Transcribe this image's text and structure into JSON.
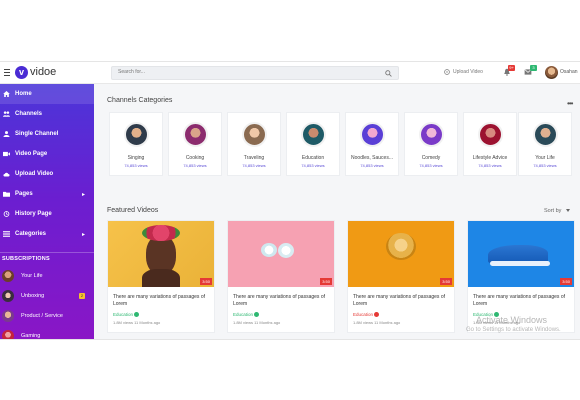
{
  "app": {
    "logo_letter": "v",
    "logo_text": "vidoe"
  },
  "header": {
    "search_placeholder": "Search for...",
    "upload_label": "Upload Video",
    "notifications_count": "9+",
    "messages_count": "3",
    "user_name": "Osahan"
  },
  "sidebar": {
    "items": [
      {
        "label": "Home",
        "icon": "home-icon",
        "has_chevron": false
      },
      {
        "label": "Channels",
        "icon": "users-icon",
        "has_chevron": false
      },
      {
        "label": "Single Channel",
        "icon": "user-icon",
        "has_chevron": false
      },
      {
        "label": "Video Page",
        "icon": "video-icon",
        "has_chevron": false
      },
      {
        "label": "Upload Video",
        "icon": "cloud-upload-icon",
        "has_chevron": false
      },
      {
        "label": "Pages",
        "icon": "folder-icon",
        "has_chevron": true
      },
      {
        "label": "History Page",
        "icon": "history-icon",
        "has_chevron": false
      },
      {
        "label": "Categories",
        "icon": "list-icon",
        "has_chevron": true
      }
    ],
    "subscriptions_title": "SUBSCRIPTIONS",
    "subscriptions": [
      {
        "label": "Your Life",
        "count": ""
      },
      {
        "label": "Unboxing",
        "count": "2"
      },
      {
        "label": "Product / Service",
        "count": ""
      },
      {
        "label": "Gaming",
        "count": ""
      }
    ]
  },
  "categories": {
    "title": "Channels Categories",
    "items": [
      {
        "name": "Singing",
        "views": "74,853 views"
      },
      {
        "name": "Cooking",
        "views": "74,853 views"
      },
      {
        "name": "Traveling",
        "views": "74,853 views"
      },
      {
        "name": "Education",
        "views": "74,853 views"
      },
      {
        "name": "Noodles, Sauces...",
        "views": "74,853 views"
      },
      {
        "name": "Comedy",
        "views": "74,853 views"
      },
      {
        "name": "Lifestyle Advice",
        "views": "74,853 views"
      },
      {
        "name": "Your Life",
        "views": "74,853 views"
      }
    ]
  },
  "featured": {
    "title": "Featured Videos",
    "sort_label": "Sort by",
    "videos": [
      {
        "title": "There are many variations of passages of Lorem",
        "channel": "Education",
        "meta": "1.8M views  11 Months ago",
        "duration": "3:50"
      },
      {
        "title": "There are many variations of passages of Lorem",
        "channel": "Education",
        "meta": "1.8M views  11 Months ago",
        "duration": "3:50"
      },
      {
        "title": "There are many variations of passages of Lorem",
        "channel": "Education",
        "meta": "1.8M views  11 Months ago",
        "duration": "3:50"
      },
      {
        "title": "There are many variations of passages of Lorem",
        "channel": "Education",
        "meta": "1.8M views  11 Months ago",
        "duration": "3:50"
      }
    ]
  },
  "watermark": {
    "line1": "Activate Windows",
    "line2": "Go to Settings to activate Windows."
  },
  "colors": {
    "accent": "#4a2bd4",
    "sidebar_end": "#8a16c6",
    "green": "#2eb872",
    "red": "#e53935"
  }
}
